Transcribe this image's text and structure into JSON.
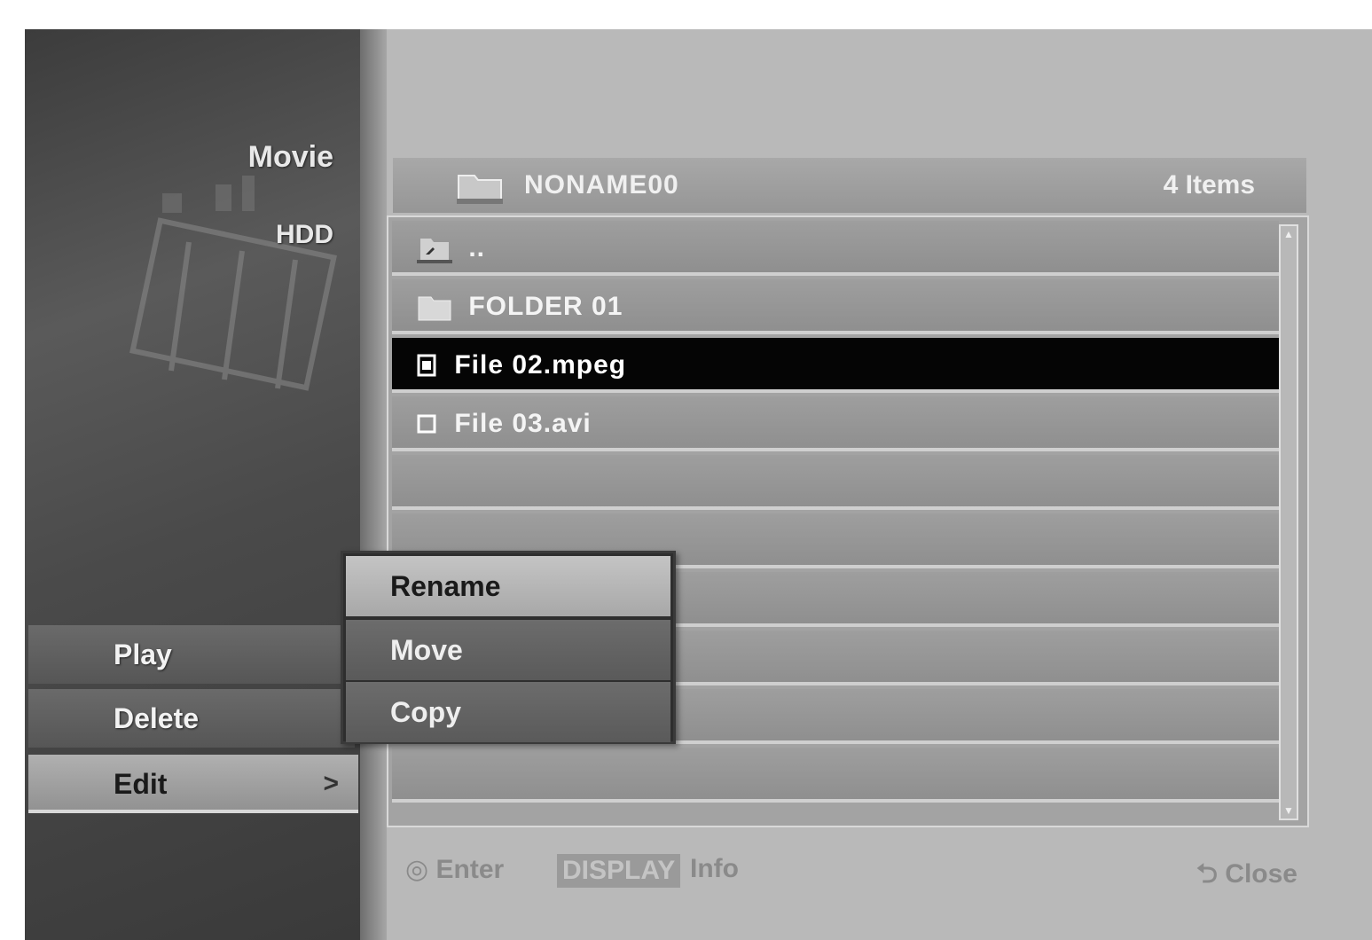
{
  "sidebar": {
    "media_type": "Movie",
    "source": "HDD",
    "menu": {
      "play": "Play",
      "delete": "Delete",
      "edit": "Edit",
      "edit_arrow": ">"
    }
  },
  "file_list": {
    "folder_name": "NONAME00",
    "item_count": "4 Items",
    "rows": [
      {
        "label": "..",
        "icon": "parent-folder-icon"
      },
      {
        "label": "FOLDER 01",
        "icon": "folder-icon"
      },
      {
        "label": "File 02.mpeg",
        "icon": "movie-file-icon",
        "selected": true
      },
      {
        "label": "File 03.avi",
        "icon": "movie-file-icon"
      }
    ]
  },
  "submenu": {
    "rename": "Rename",
    "move": "Move",
    "copy": "Copy"
  },
  "footer": {
    "enter": "Enter",
    "info_button": "DISPLAY",
    "info": "Info",
    "close": "Close"
  }
}
